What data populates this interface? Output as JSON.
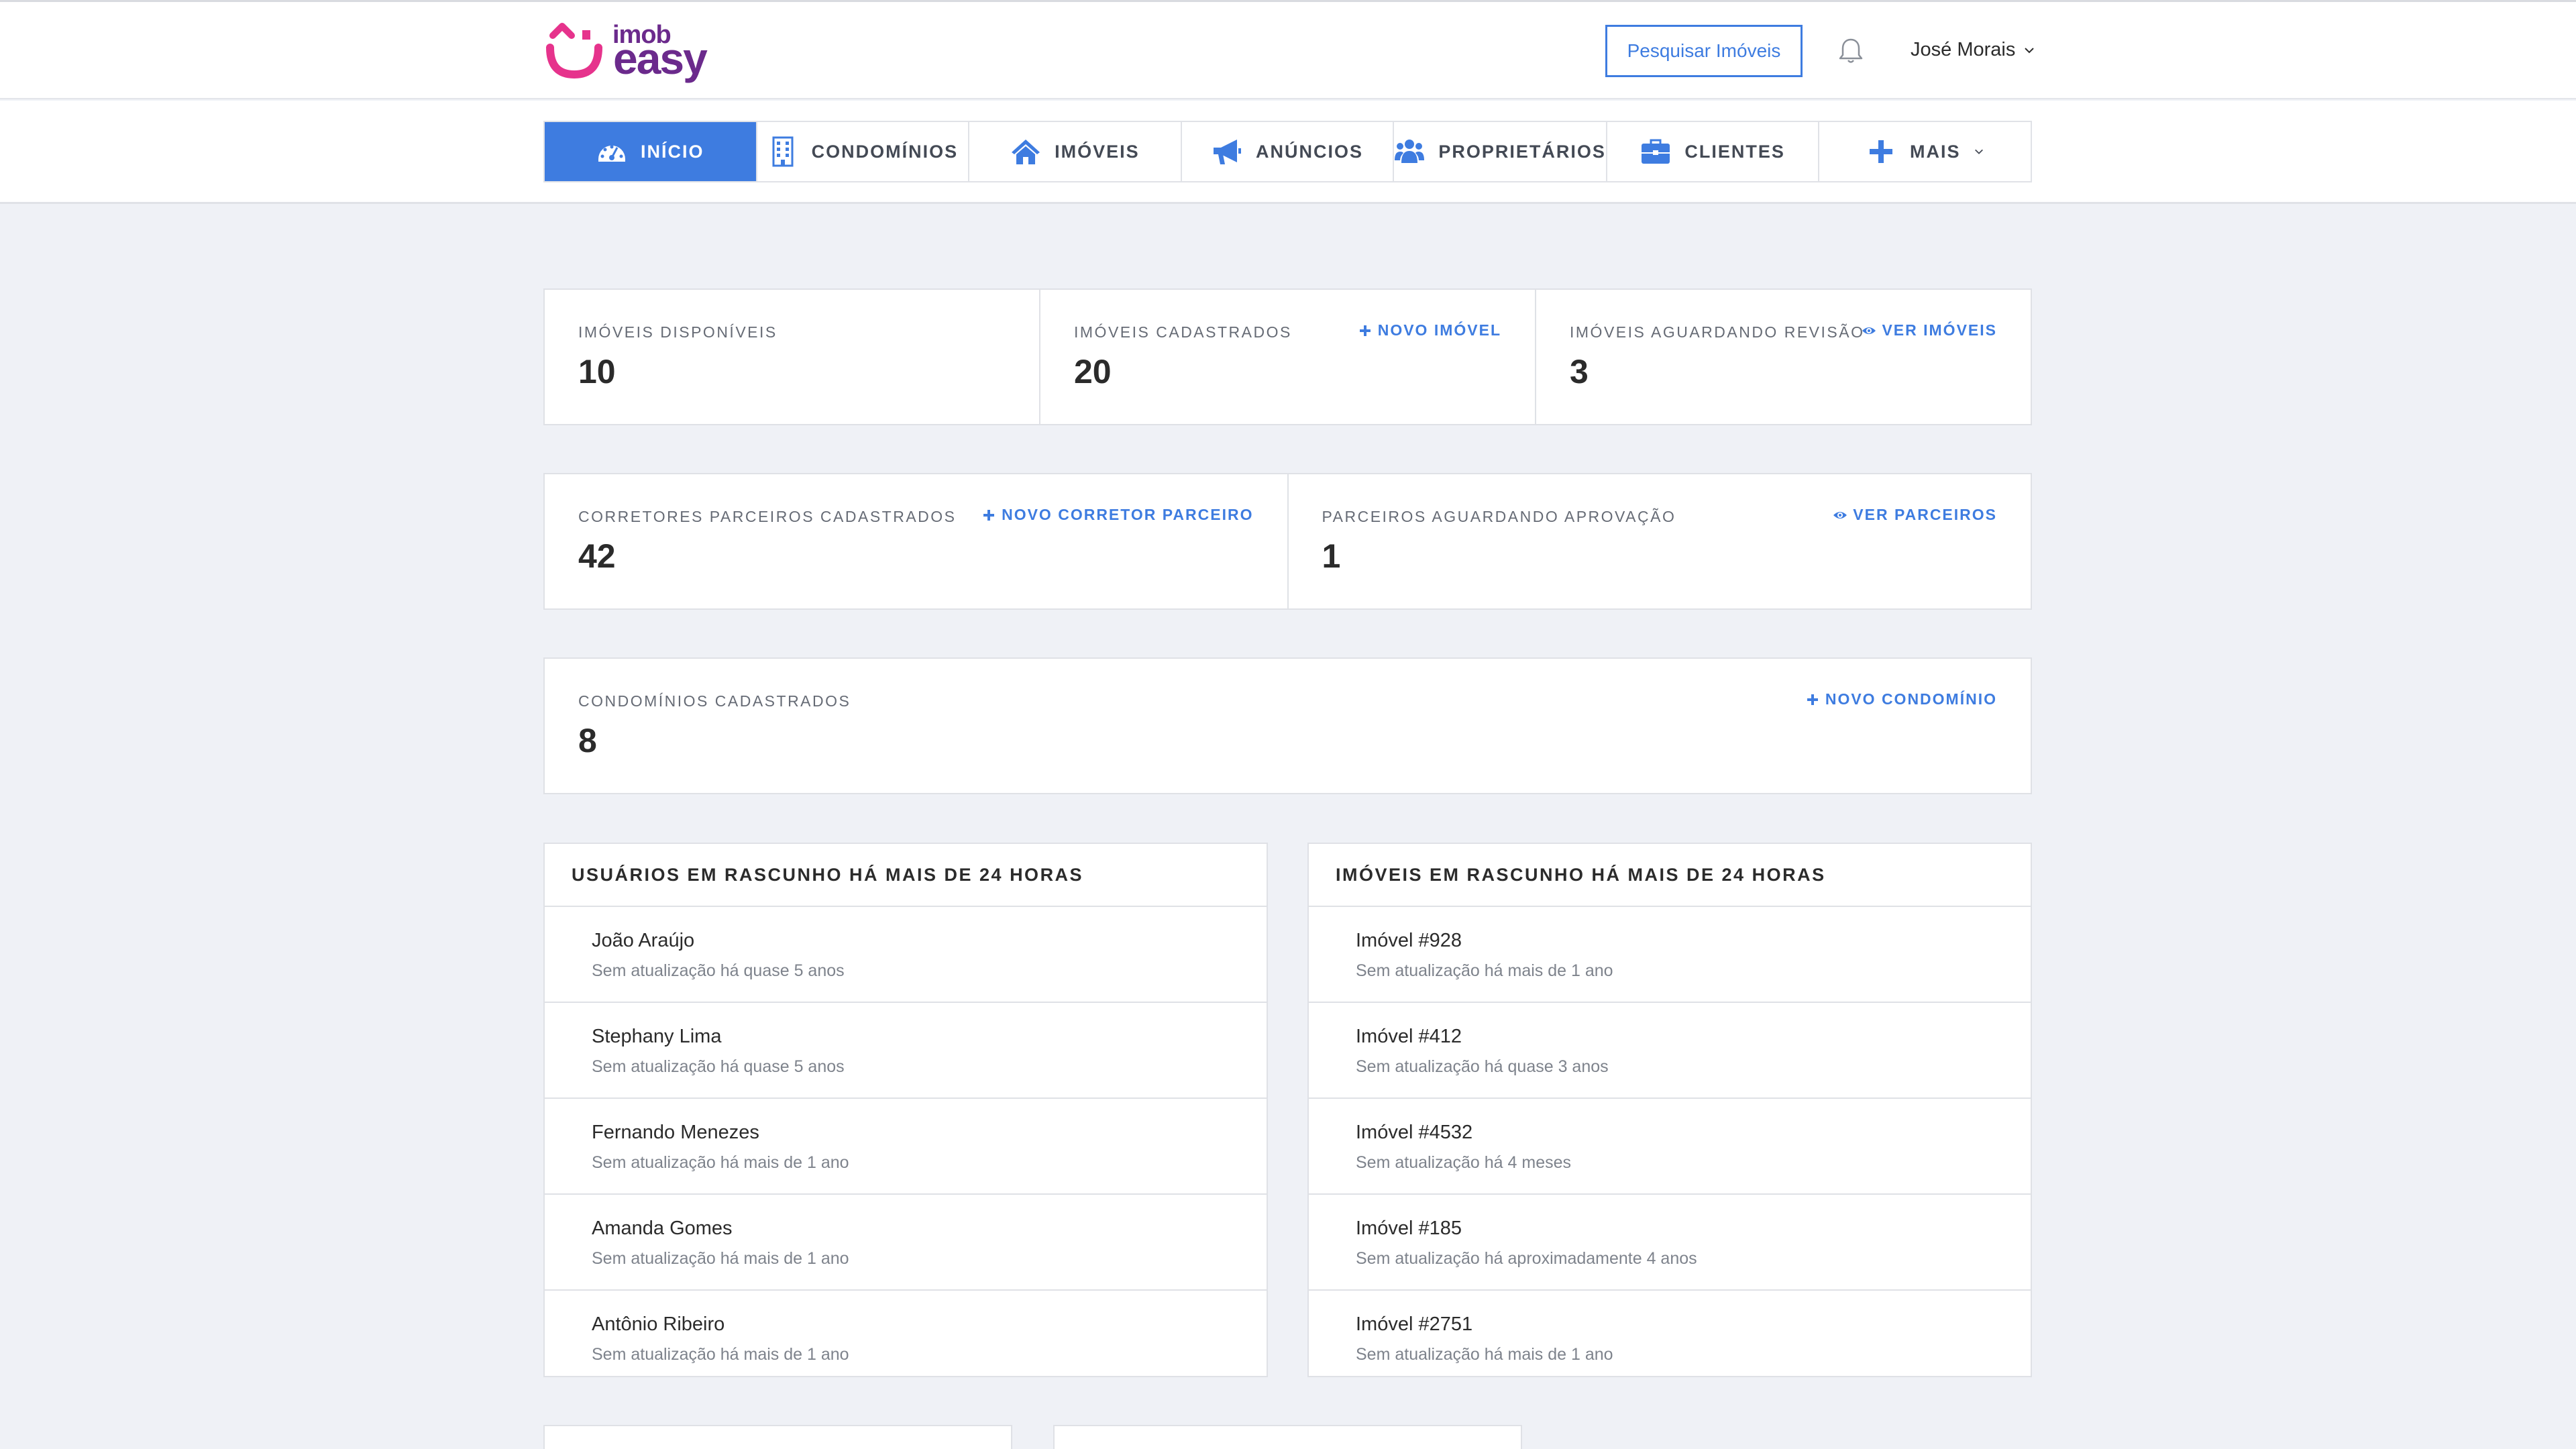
{
  "brand": {
    "name_top": "imob",
    "name_bottom": "easy",
    "color_primary": "#6b2a8c",
    "color_accent": "#e6338c"
  },
  "header": {
    "search_button": "Pesquisar Imóveis",
    "notifications_icon": "bell-icon",
    "user_name": "José Morais"
  },
  "nav": {
    "active_color": "#3e7ce0",
    "tabs": [
      {
        "label": "INÍCIO",
        "icon": "dashboard-icon",
        "active": true
      },
      {
        "label": "CONDOMÍNIOS",
        "icon": "building-icon"
      },
      {
        "label": "IMÓVEIS",
        "icon": "home-icon"
      },
      {
        "label": "ANÚNCIOS",
        "icon": "megaphone-icon"
      },
      {
        "label": "PROPRIETÁRIOS",
        "icon": "users-icon"
      },
      {
        "label": "CLIENTES",
        "icon": "briefcase-icon"
      },
      {
        "label": "MAIS",
        "icon": "plus-icon"
      }
    ]
  },
  "stats_row1": [
    {
      "label": "IMÓVEIS DISPONÍVEIS",
      "value": "10"
    },
    {
      "label": "IMÓVEIS CADASTRADOS",
      "value": "20",
      "action": "NOVO IMÓVEL"
    },
    {
      "label": "IMÓVEIS AGUARDANDO REVISÃO",
      "value": "3",
      "action": "VER IMÓVEIS"
    }
  ],
  "stats_row2": [
    {
      "label": "CORRETORES PARCEIROS CADASTRADOS",
      "value": "42",
      "action": "NOVO CORRETOR PARCEIRO"
    },
    {
      "label": "PARCEIROS AGUARDANDO APROVAÇÃO",
      "value": "1",
      "action": "VER PARCEIROS"
    }
  ],
  "stats_row3": [
    {
      "label": "CONDOMÍNIOS CADASTRADOS",
      "value": "8",
      "action": "NOVO CONDOMÍNIO"
    }
  ],
  "draft_users": {
    "title": "USUÁRIOS EM RASCUNHO HÁ MAIS DE 24 HORAS",
    "items": [
      {
        "name": "João Araújo",
        "sub": "Sem atualização há quase 5 anos"
      },
      {
        "name": "Stephany Lima",
        "sub": "Sem atualização há quase 5 anos"
      },
      {
        "name": "Fernando Menezes",
        "sub": "Sem atualização há mais de 1 ano"
      },
      {
        "name": "Amanda Gomes",
        "sub": "Sem atualização há mais de 1 ano"
      },
      {
        "name": "Antônio Ribeiro",
        "sub": "Sem atualização há mais de 1 ano"
      }
    ]
  },
  "draft_properties": {
    "title": "IMÓVEIS EM RASCUNHO HÁ MAIS DE 24 HORAS",
    "items": [
      {
        "name": "Imóvel #928",
        "sub": "Sem atualização há mais de 1 ano"
      },
      {
        "name": "Imóvel #412",
        "sub": "Sem atualização há quase 3 anos"
      },
      {
        "name": "Imóvel #4532",
        "sub": "Sem atualização há 4 meses"
      },
      {
        "name": "Imóvel #185",
        "sub": "Sem atualização há aproximadamente 4 anos"
      },
      {
        "name": "Imóvel #2751",
        "sub": "Sem atualização há mais de 1 ano"
      }
    ]
  }
}
